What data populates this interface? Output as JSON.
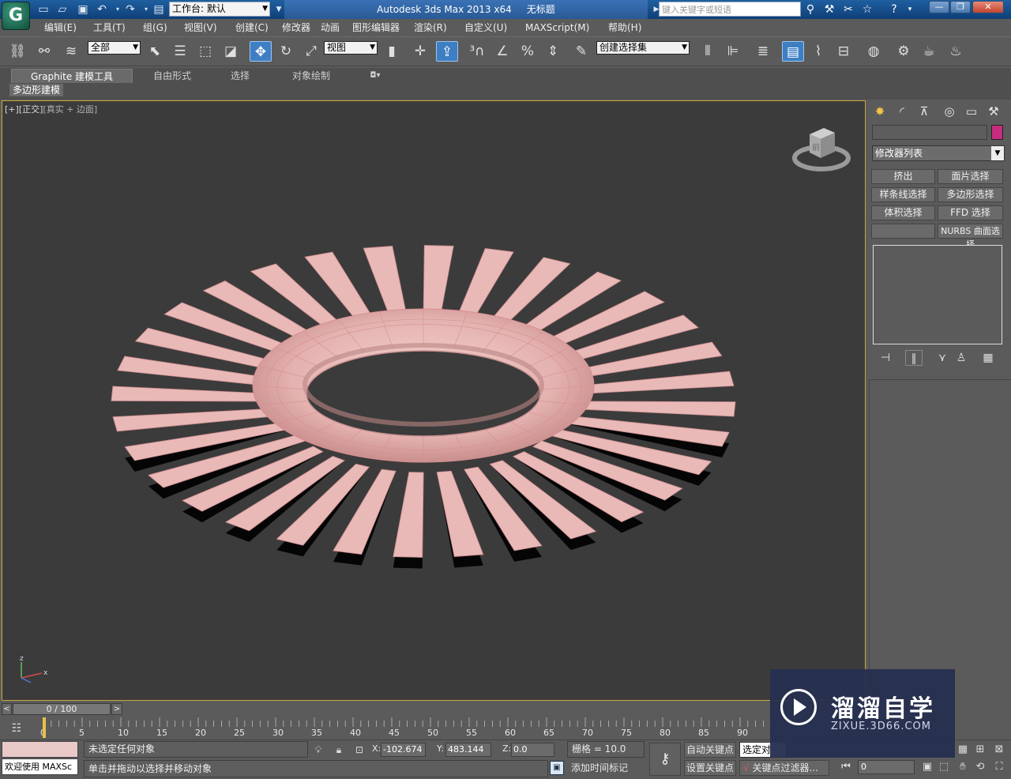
{
  "titlebar": {
    "workspace": "工作台: 默认",
    "app_title": "Autodesk 3ds Max  2013 x64",
    "doc_title": "无标题",
    "search_placeholder": "键入关键字或短语",
    "minimize": "—",
    "restore": "❐",
    "close": "✕"
  },
  "menu": [
    "编辑(E)",
    "工具(T)",
    "组(G)",
    "视图(V)",
    "创建(C)",
    "修改器",
    "动画",
    "图形编辑器",
    "渲染(R)",
    "自定义(U)",
    "MAXScript(M)",
    "帮助(H)"
  ],
  "toolbar": {
    "filter": "全部",
    "coord": "视图",
    "selection_set": "创建选择集"
  },
  "ribbon": {
    "tabs": [
      "Graphite 建模工具",
      "自由形式",
      "选择",
      "对象绘制"
    ],
    "panel_label": "多边形建模"
  },
  "viewport": {
    "label_bracket_plus": "[+]",
    "label_view": "[正交]",
    "label_shading": "[真实 + 边面]",
    "viewcube_face": "前",
    "axis_z": "z",
    "axis_x": "x"
  },
  "command_panel": {
    "modifier_list": "修改器列表",
    "buttons": [
      "挤出",
      "面片选择",
      "样条线选择",
      "多边形选择",
      "体积选择",
      "FFD 选择",
      "",
      "NURBS 曲面选择"
    ],
    "object_color": "#c72c7e"
  },
  "timeline": {
    "frame_display": "0 / 100",
    "ticks": [
      "0",
      "5",
      "10",
      "15",
      "20",
      "25",
      "30",
      "35",
      "40",
      "45",
      "50",
      "55",
      "60",
      "65",
      "70",
      "75",
      "80",
      "85",
      "90"
    ]
  },
  "statusbar": {
    "welcome": "欢迎使用 MAXSc",
    "selection_status": "未选定任何对象",
    "prompt": "单击并拖动以选择并移动对象",
    "x_label": "X:",
    "x_value": "-102.674",
    "y_label": "Y:",
    "y_value": "483.144",
    "z_label": "Z:",
    "z_value": "0.0",
    "grid": "栅格 = 10.0",
    "add_time_tag": "添加时间标记",
    "auto_key": "自动关键点",
    "set_key": "设置关键点",
    "selected_set": "选定对",
    "key_filters": "关键点过滤器...",
    "current_frame": "0"
  },
  "watermark": {
    "title": "溜溜自学",
    "url": "ZIXUE.3D66.COM"
  },
  "colors": {
    "model": "#e9b9b7",
    "viewport_bg": "#3b3b3b",
    "ui_bg": "#5b5b5b",
    "active_tool": "#3e7fc4"
  }
}
